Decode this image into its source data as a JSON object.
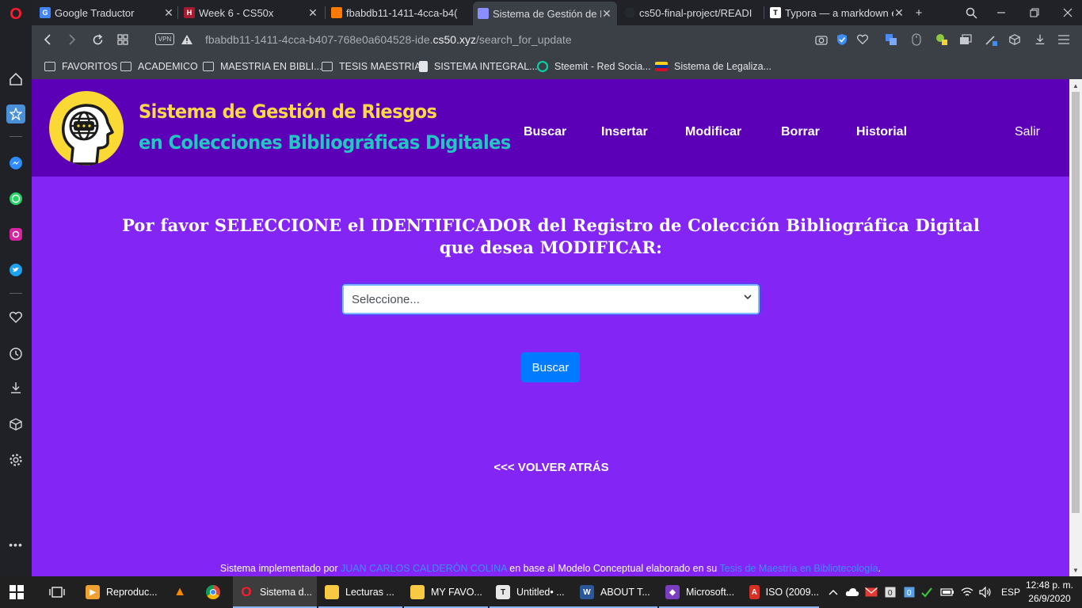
{
  "browser": {
    "tabs": [
      {
        "label": "Google Traductor",
        "fav_color": "#4285f4",
        "fav_glyph": "G"
      },
      {
        "label": "Week 6 - CS50x",
        "fav_color": "#a51c30",
        "fav_glyph": "H"
      },
      {
        "label": "fbabdb11-1411-4cca-b4(",
        "fav_color": "#ff7a00",
        "fav_glyph": ""
      },
      {
        "label": "Sistema de Gestión de R",
        "fav_color": "#8a8fff",
        "fav_glyph": ""
      },
      {
        "label": "cs50-final-project/READI",
        "fav_color": "#24292e",
        "fav_glyph": ""
      },
      {
        "label": "Typora — a markdown e",
        "fav_color": "#ffffff",
        "fav_glyph": "T"
      }
    ],
    "new_tab": "+",
    "url_path_prefix": "fbabdb11-1411-4cca-b407-768e0a604528-ide.",
    "url_host": "cs50.xyz",
    "url_path": "/search_for_update",
    "vpn_label": "VPN"
  },
  "bookmarks": [
    {
      "label": "FAVORITOS",
      "type": "folder"
    },
    {
      "label": "ACADEMICO",
      "type": "folder"
    },
    {
      "label": "MAESTRIA EN BIBLI...",
      "type": "folder"
    },
    {
      "label": "TESIS MAESTRIA",
      "type": "folder"
    },
    {
      "label": "SISTEMA INTEGRAL...",
      "type": "doc"
    },
    {
      "label": "Steemit - Red Socia...",
      "type": "steem"
    },
    {
      "label": "Sistema de Legaliza...",
      "type": "flag"
    }
  ],
  "site": {
    "brand_line1": "Sistema de Gestión de Riesgos",
    "brand_line2": "en Colecciones Bibliográficas Digitales",
    "menu": [
      "Buscar",
      "Insertar",
      "Modificar",
      "Borrar",
      "Historial"
    ],
    "logout": "Salir",
    "colors": {
      "header": "#5c00b8",
      "page": "#8326f5",
      "brand_yellow": "#ffd84a",
      "brand_teal": "#23c6c2",
      "button": "#007bff"
    }
  },
  "main": {
    "heading": "Por favor SELECCIONE el IDENTIFICADOR del Registro de Colección Bibliográfica Digital que desea MODIFICAR:",
    "select_value": "Seleccione...",
    "search_button": "Buscar",
    "back_link": "<<< VOLVER ATRÁS"
  },
  "footer": {
    "text1": "Sistema implementado por ",
    "author": "JUAN CARLOS CALDERÓN COLINA",
    "text2": " en base al Modelo Conceptual elaborado en su ",
    "thesis": "Tesis de Maestría en Bibliotecología",
    "text3": "."
  },
  "taskbar": {
    "tasks": [
      {
        "label": "Reproduc...",
        "color": "#f0a030",
        "glyph": "▶"
      },
      {
        "label": "",
        "color": "#ff8800",
        "glyph": "▲"
      },
      {
        "label": "",
        "color": "#db4437",
        "glyph": "●"
      },
      {
        "label": "Sistema d...",
        "color": "#ff1b2d",
        "glyph": "O"
      },
      {
        "label": "Lecturas ...",
        "color": "#f8c942",
        "glyph": ""
      },
      {
        "label": "MY FAVO...",
        "color": "#f8c942",
        "glyph": ""
      },
      {
        "label": "Untitled• ...",
        "color": "#e8e8e8",
        "glyph": "T"
      },
      {
        "label": "ABOUT T...",
        "color": "#2b579a",
        "glyph": "W"
      },
      {
        "label": "Microsoft...",
        "color": "#7a3fc0",
        "glyph": "◆"
      },
      {
        "label": "ISO (2009...",
        "color": "#d93025",
        "glyph": "A"
      }
    ],
    "language": "ESP",
    "time": "12:48 p. m.",
    "date": "26/9/2020"
  }
}
